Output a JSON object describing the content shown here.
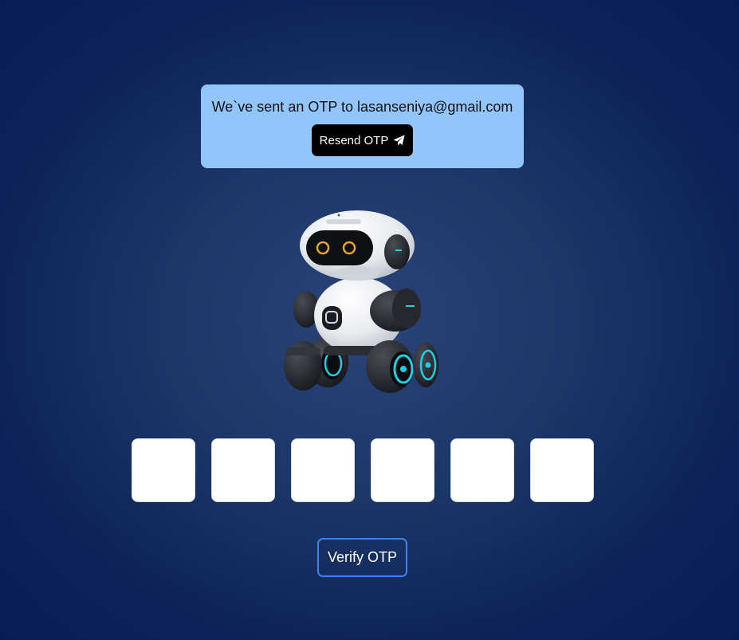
{
  "notice": {
    "message": "We`ve sent an OTP to lasanseniya@gmail.com",
    "resend_label": "Resend OTP",
    "resend_icon": "paper-plane-icon",
    "background_color": "#93c5fd"
  },
  "mascot": {
    "icon": "robot-icon"
  },
  "otp": {
    "digits": [
      "",
      "",
      "",
      "",
      "",
      ""
    ]
  },
  "verify": {
    "label": "Verify OTP",
    "border_color": "#3b82f6"
  }
}
